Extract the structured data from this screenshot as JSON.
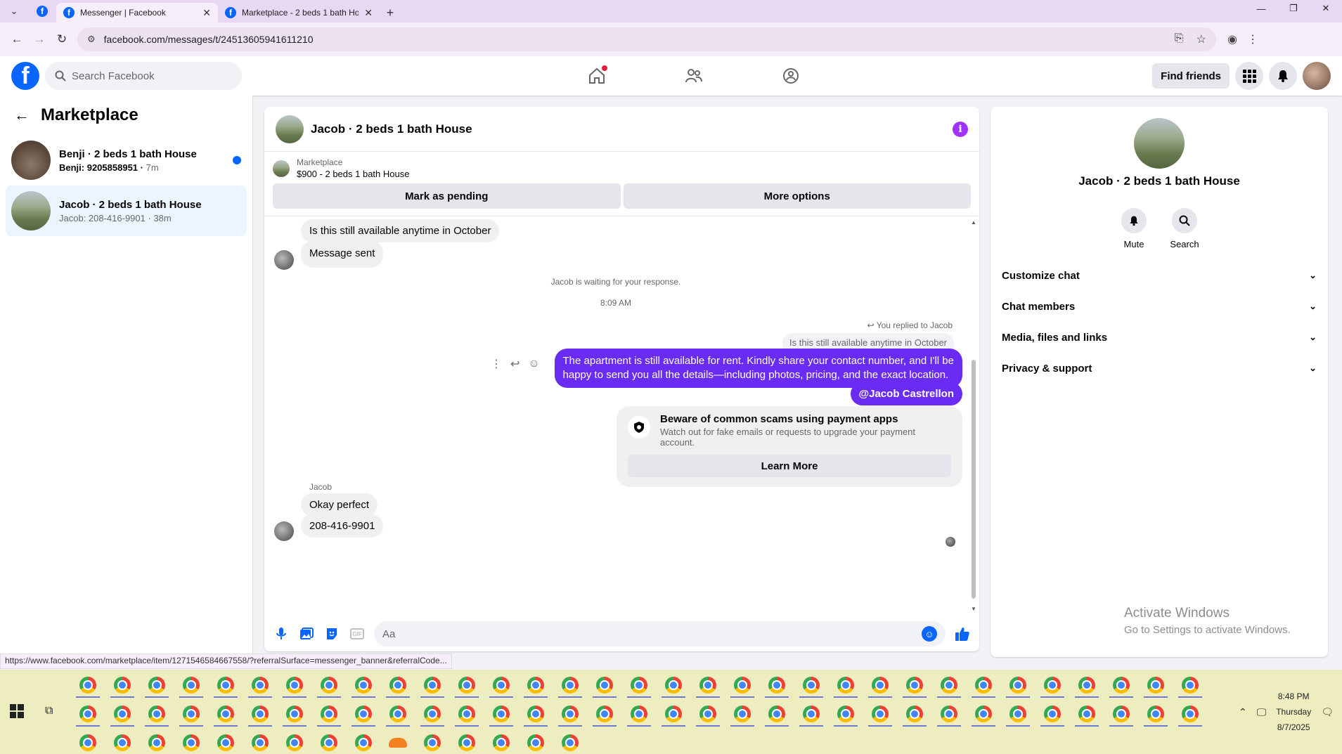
{
  "browser": {
    "tabs": [
      {
        "title": "Messenger | Facebook",
        "active": true
      },
      {
        "title": "Marketplace - 2 beds 1 bath Ho",
        "active": false
      }
    ],
    "url": "facebook.com/messages/t/24513605941611210",
    "status_link": "https://www.facebook.com/marketplace/item/1271546584667558/?referralSurface=messenger_banner&referralCode..."
  },
  "fb_header": {
    "search_placeholder": "Search Facebook",
    "find_friends": "Find friends"
  },
  "left_panel": {
    "title": "Marketplace",
    "conversations": [
      {
        "name": "Benji · 2 beds 1 bath House",
        "preview": "Benji: 9205858951",
        "time": "7m",
        "unread": true
      },
      {
        "name": "Jacob · 2 beds 1 bath House",
        "preview": "Jacob: 208-416-9901",
        "time": "38m",
        "unread": false
      }
    ]
  },
  "chat": {
    "title": "Jacob · 2 beds 1 bath House",
    "marketplace_label": "Marketplace",
    "listing": "$900 - 2 beds 1 bath House",
    "mark_pending": "Mark as pending",
    "more_options": "More options",
    "messages": {
      "in1": "Is this still available anytime in October",
      "in2": "Message sent",
      "waiting": "Jacob is waiting for your response.",
      "timestamp": "8:09 AM",
      "replied_note": "You replied to Jacob",
      "quoted": "Is this still available anytime in October",
      "out1_line1": "The apartment is still available for rent. Kindly share your contact number, and I'll be",
      "out1_line2": "happy to send you all the details—including photos, pricing, and the exact location.",
      "mention": "@Jacob Castrellon",
      "scam_title": "Beware of common scams using payment apps",
      "scam_desc": "Watch out for fake emails or requests to upgrade your payment account.",
      "learn_more": "Learn More",
      "sender": "Jacob",
      "in3": "Okay perfect",
      "in4": "208-416-9901"
    },
    "composer_placeholder": "Aa",
    "gif_label": "GIF"
  },
  "right_panel": {
    "name": "Jacob · 2 beds 1 bath House",
    "mute": "Mute",
    "search": "Search",
    "sections": [
      "Customize chat",
      "Chat members",
      "Media, files and links",
      "Privacy & support"
    ]
  },
  "watermark": {
    "line1": "Activate Windows",
    "line2": "Go to Settings to activate Windows."
  },
  "taskbar": {
    "time": "8:48 PM",
    "day": "Thursday",
    "date": "8/7/2025"
  },
  "colors": {
    "fb_blue": "#0866ff",
    "outgoing_bubble": "#6a2bf2",
    "info_purple": "#a033ff",
    "taskbar_bg": "#eeedbf"
  }
}
